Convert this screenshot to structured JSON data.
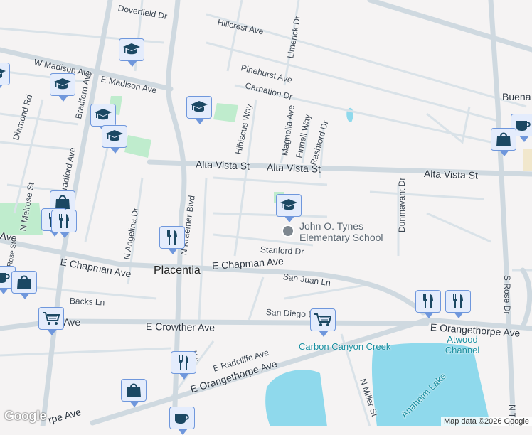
{
  "streets": {
    "doverfield": "Doverfield Dr",
    "hillcrest": "Hillcrest Ave",
    "w_madison": "W Madison Ave",
    "e_madison": "E Madison Ave",
    "pinehurst": "Pinehurst Ave",
    "carnation": "Carnation Dr",
    "limerick": "Limerick Dr",
    "bradford1": "Bradford Ave",
    "bradford2": "Bradford Ave",
    "diamond": "Diamond Rd",
    "hibiscus": "Hibiscus Way",
    "magnolia": "Magnolia Ave",
    "finnell": "Finnell Way",
    "rashford": "Rashford Dr",
    "alta1": "Alta Vista St",
    "alta2": "Alta Vista St",
    "alta3": "Alta Vista St",
    "melrose": "N Melrose St",
    "angelina": "N Angelina Dr",
    "kraemer": "N Kraemer Blvd",
    "dunmavant": "Dunmavant Dr",
    "rose": "S Rose Dr",
    "stanford": "Stanford Dr",
    "chapman_w": "E Chapman Ave",
    "chapman": "E Chapman Ave",
    "ave_left": "Ave",
    "rose_st": "Rose St",
    "san_juan": "San Juan Ln",
    "backs": "Backs Ln",
    "san_diego": "San Diego Ln",
    "crowther_w": "ther Ave",
    "crowther": "E Crowther Ave",
    "orangethorpe_e": "E Orangethorpe Ave",
    "orangethorpe": "E Orangethorpe Ave",
    "orangethorpe_w": "rpe Ave",
    "radcliffe": "E Radcliffe Ave",
    "kraemer_s": "N K...",
    "miller": "N Miller St",
    "tustin": "N Tus",
    "buena": "Buena V"
  },
  "places": {
    "city": "Placentia",
    "school": "John O. Tynes Elementary School",
    "carbon_creek": "Carbon Canyon Creek",
    "atwood": "Atwood Channel",
    "lake": "Anaheim Lake"
  },
  "markers": [
    {
      "type": "school",
      "icon": "graduation-cap-icon"
    },
    {
      "type": "restaurant",
      "icon": "fork-knife-icon"
    },
    {
      "type": "shopping",
      "icon": "shopping-bag-icon"
    },
    {
      "type": "grocery",
      "icon": "shopping-cart-icon"
    },
    {
      "type": "cafe",
      "icon": "coffee-cup-icon"
    }
  ],
  "attribution": "Map data ©2026 Google",
  "logo": "Google",
  "colors": {
    "road": "#d3dde4",
    "water": "#8fd9ec",
    "park": "#bfeccd",
    "pin_bg": "#e4ecfc",
    "pin_border": "#6f97dc",
    "icon": "#1b4863"
  }
}
